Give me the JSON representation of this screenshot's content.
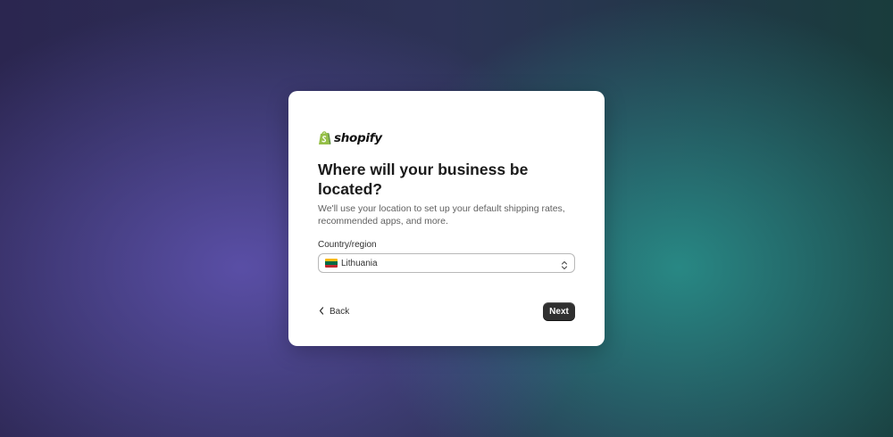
{
  "brand": {
    "name": "shopify",
    "logo_icon": "shopify-bag-icon",
    "logo_color": "#95bf47"
  },
  "form": {
    "title": "Where will your business be located?",
    "subtitle": "We'll use your location to set up your default shipping rates, recommended apps, and more.",
    "country_label": "Country/region",
    "country_value": "Lithuania",
    "country_flag_colors": [
      "#fdb913",
      "#006a44",
      "#c1272d"
    ]
  },
  "actions": {
    "back_label": "Back",
    "next_label": "Next"
  },
  "colors": {
    "primary_button": "#303030",
    "card_background": "#ffffff"
  }
}
